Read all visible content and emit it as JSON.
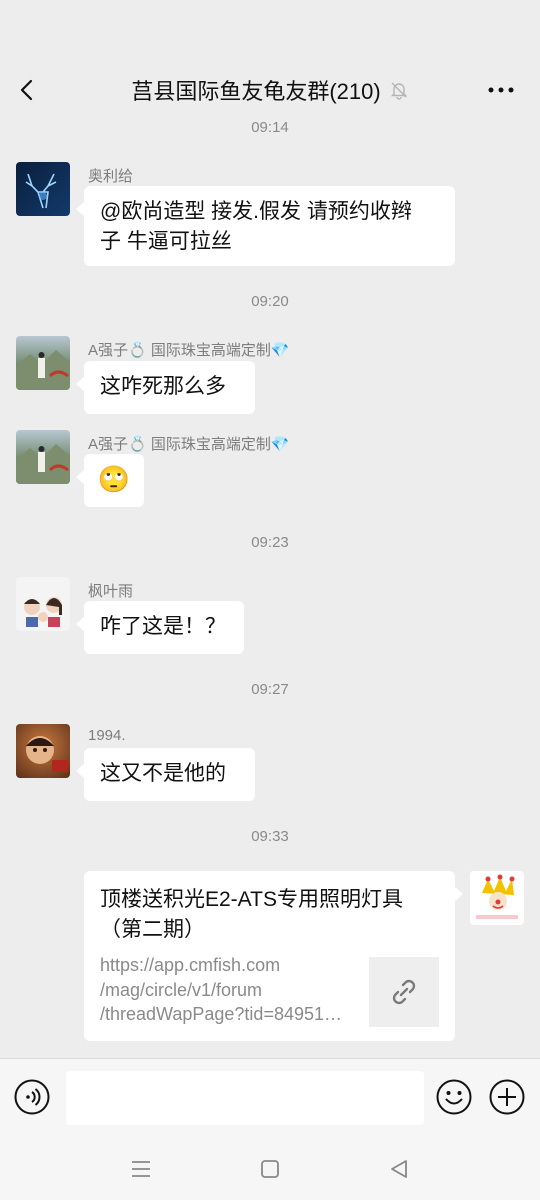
{
  "header": {
    "title": "莒县国际鱼友龟友群(210)",
    "back_icon": "back-arrow-icon",
    "mute_icon": "bell-muted-icon",
    "more_icon": "more-dots-icon"
  },
  "messages": [
    {
      "time": "09:14",
      "sender": "奥利给",
      "text_line1": "@欧尚造型 接发.假发 请预约收辫",
      "text_line2": "子  牛逼可拉丝"
    },
    {
      "time": "09:20",
      "sender": "A强子💍 国际珠宝高端定制💎",
      "text": "这咋死那么多"
    },
    {
      "sender": "A强子💍 国际珠宝高端定制💎",
      "emoji": "🙄"
    },
    {
      "time": "09:23",
      "sender": "枫叶雨",
      "text": "咋了这是！？"
    },
    {
      "time": "09:27",
      "sender": "1994.",
      "text": "这又不是他的"
    },
    {
      "time": "09:33",
      "link_title_1": "顶楼送积光E2-ATS专用照明灯具",
      "link_title_2": "（第二期）",
      "url_1": "https://app.cmfish.com",
      "url_2": "/mag/circle/v1/forum",
      "url_3": "/threadWapPage?tid=84951…"
    }
  ],
  "input_bar": {
    "voice_icon": "voice-icon",
    "emoji_icon": "emoji-icon",
    "plus_icon": "plus-icon",
    "value": ""
  },
  "colors": {
    "background": "#ededed",
    "bubble": "#ffffff",
    "meta_text": "#8a8a8a"
  }
}
